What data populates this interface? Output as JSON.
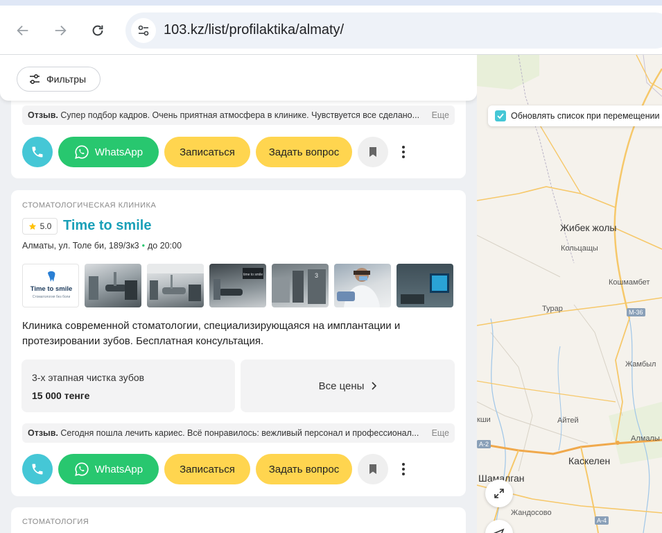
{
  "browser": {
    "url": "103.kz/list/profilaktika/almaty/"
  },
  "filters": {
    "label": "Фильтры"
  },
  "card_prev": {
    "review_prefix": "Отзыв.",
    "review_text": "Супер подбор кадров. Очень приятная атмосфера в клинике. Чувствуется все сделано...",
    "review_more": "Еще",
    "actions": {
      "whatsapp": "WhatsApp",
      "book": "Записаться",
      "ask": "Задать вопрос"
    }
  },
  "card_main": {
    "category": "стоматологическая клиника",
    "rating": "5.0",
    "title": "Time to smile",
    "address": "Алматы, ул. Толе би, 189/3к3",
    "hours": "до 20:00",
    "logo_title": "Time to smile",
    "logo_subtitle": "Стоматология без боли",
    "description": "Клиника современной стоматологии, специализирующаяся на имплантации и протезировании зубов. Бесплатная консультация.",
    "price": {
      "name": "3-х этапная чистка зубов",
      "value": "15 000 тенге"
    },
    "all_prices": "Все цены",
    "review_prefix": "Отзыв.",
    "review_text": "Сегодня пошла лечить кариес. Всё понравилось: вежливый персонал и профессионал...",
    "review_more": "Еще",
    "actions": {
      "whatsapp": "WhatsApp",
      "book": "Записаться",
      "ask": "Задать вопрос"
    }
  },
  "card_next": {
    "category": "стоматология"
  },
  "map": {
    "update_on_move": "Обновлять список при перемещении",
    "labels": {
      "zhibek_zholy": "Жибек жолы",
      "koltsashy": "Кольцащы",
      "koshmambet": "Кошмамбет",
      "turar": "Турар",
      "zhambyl": "Жамбыл",
      "aitei": "Айтей",
      "kshi": "кши",
      "almaly": "Алмалы",
      "kaskelen": "Каскелен",
      "shamalgan": "Шамалган",
      "zhandosovo": "Жандосово"
    },
    "shields": {
      "m36": "М-36",
      "a2": "А-2",
      "a4": "А-4"
    }
  },
  "colors": {
    "accent_teal": "#1aa0b8",
    "phone_button": "#45c7d6",
    "whatsapp_button": "#28c76f",
    "primary_yellow": "#ffd54f"
  }
}
